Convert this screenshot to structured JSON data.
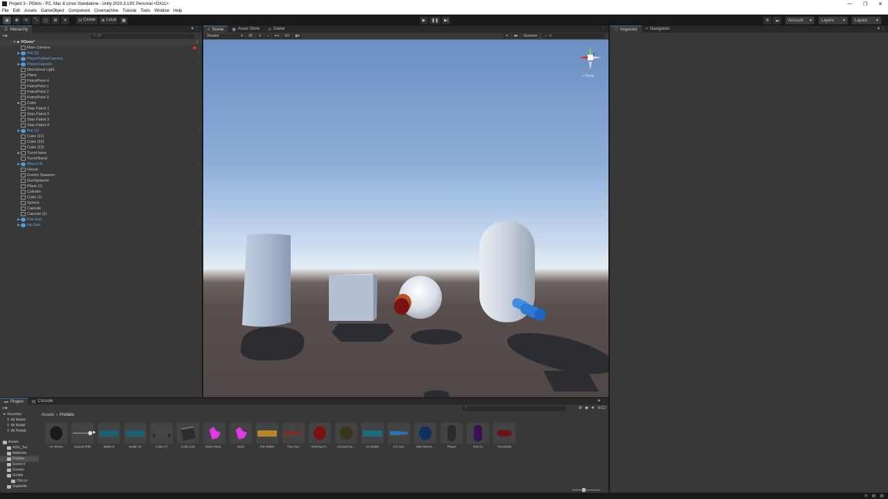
{
  "window": {
    "title": "Project 3 - POints - PC, Mac & Linux Standalone - Unity 2020.3.13f1 Personal <DX11>",
    "minimize": "—",
    "maximize": "❐",
    "close": "✕"
  },
  "menu": [
    "File",
    "Edit",
    "Assets",
    "GameObject",
    "Component",
    "Cinemachine",
    "Tutorial",
    "Tools",
    "Window",
    "Help"
  ],
  "toolbar": {
    "pivot": "Center",
    "space": "Local",
    "account": "Account",
    "layers": "Layers",
    "layout": "Layout"
  },
  "hierarchy": {
    "tab": "Hierarchy",
    "add": "+▾",
    "search_placeholder": "All",
    "scene": "POints*",
    "items": [
      {
        "name": "Main Camera",
        "prefab": false,
        "arrow": ""
      },
      {
        "name": "Rat (2)",
        "prefab": true,
        "arrow": "▶"
      },
      {
        "name": "PlayerFollowCamera",
        "prefab": true,
        "arrow": ""
      },
      {
        "name": "PlayerCapsule",
        "prefab": true,
        "arrow": "▶"
      },
      {
        "name": "Directional Light",
        "prefab": false,
        "arrow": ""
      },
      {
        "name": "Plane",
        "prefab": false,
        "arrow": ""
      },
      {
        "name": "PatrolPoint 4",
        "prefab": false,
        "arrow": ""
      },
      {
        "name": "PatrolPoint 1",
        "prefab": false,
        "arrow": ""
      },
      {
        "name": "PatrolPoint 2",
        "prefab": false,
        "arrow": ""
      },
      {
        "name": "PatrolPoint 3",
        "prefab": false,
        "arrow": ""
      },
      {
        "name": "Cube",
        "prefab": false,
        "arrow": "▶"
      },
      {
        "name": "Stair Patrol 1",
        "prefab": false,
        "arrow": ""
      },
      {
        "name": "Stair Patrol 2",
        "prefab": false,
        "arrow": ""
      },
      {
        "name": "Stair Patrol 3",
        "prefab": false,
        "arrow": ""
      },
      {
        "name": "Stair Patrol 4",
        "prefab": false,
        "arrow": ""
      },
      {
        "name": "Rat (1)",
        "prefab": true,
        "arrow": "▶"
      },
      {
        "name": "Cube (21)",
        "prefab": false,
        "arrow": ""
      },
      {
        "name": "Cube (22)",
        "prefab": false,
        "arrow": ""
      },
      {
        "name": "Cube (23)",
        "prefab": false,
        "arrow": ""
      },
      {
        "name": "Turret base",
        "prefab": false,
        "arrow": "▶"
      },
      {
        "name": "TurretStand",
        "prefab": false,
        "arrow": ""
      },
      {
        "name": "Move2 Ai",
        "prefab": true,
        "arrow": "▶"
      },
      {
        "name": "House",
        "prefab": false,
        "arrow": ""
      },
      {
        "name": "Enemy Spawner",
        "prefab": false,
        "arrow": ""
      },
      {
        "name": "GunSpawner",
        "prefab": false,
        "arrow": ""
      },
      {
        "name": "Plane (1)",
        "prefab": false,
        "arrow": ""
      },
      {
        "name": "Cylinder",
        "prefab": false,
        "arrow": ""
      },
      {
        "name": "Cube (1)",
        "prefab": false,
        "arrow": ""
      },
      {
        "name": "Sphere",
        "prefab": false,
        "arrow": ""
      },
      {
        "name": "Capsule",
        "prefab": false,
        "arrow": ""
      },
      {
        "name": "Capsule (1)",
        "prefab": false,
        "arrow": ""
      },
      {
        "name": "Fire Gun",
        "prefab": true,
        "arrow": "▶"
      },
      {
        "name": "Ice Gun",
        "prefab": true,
        "arrow": "▶"
      }
    ]
  },
  "scene": {
    "tabs": [
      "Scene",
      "Asset Store",
      "Game"
    ],
    "shading": "Shaded",
    "mode_2d": "2D",
    "gizmos": "Gizmos",
    "search_placeholder": "All",
    "persp": "< Persp",
    "colors": {
      "sky_top": "#6b8fc4",
      "horizon": "#e6ecf2",
      "ground": "#584e4d"
    }
  },
  "project": {
    "tabs": [
      "Project",
      "Console"
    ],
    "add": "+▾",
    "count": "12",
    "breadcrumb_root": "Assets",
    "breadcrumb_sep": "›",
    "breadcrumb_current": "Prefabs",
    "tree": [
      {
        "label": "Favorites",
        "kind": "star",
        "indent": 0
      },
      {
        "label": "All Materi",
        "kind": "search",
        "indent": 1
      },
      {
        "label": "All Model",
        "kind": "search",
        "indent": 1
      },
      {
        "label": "All Prefab",
        "kind": "search",
        "indent": 1
      },
      {
        "label": "",
        "kind": "spacer",
        "indent": 0
      },
      {
        "label": "Assets",
        "kind": "folder",
        "indent": 0
      },
      {
        "label": "ADG_Tex",
        "kind": "folder",
        "indent": 1
      },
      {
        "label": "Materials",
        "kind": "folder",
        "indent": 1
      },
      {
        "label": "Prefabs",
        "kind": "folder",
        "indent": 1,
        "selected": true
      },
      {
        "label": "Scene 0",
        "kind": "folder",
        "indent": 1
      },
      {
        "label": "Scenes",
        "kind": "folder",
        "indent": 1
      },
      {
        "label": "Scripts",
        "kind": "folder",
        "indent": 1
      },
      {
        "label": "Old scr",
        "kind": "folder",
        "indent": 2
      },
      {
        "label": "StarterAs",
        "kind": "folder",
        "indent": 1
      }
    ],
    "assets": [
      {
        "label": "Air stricity",
        "color": "#1a1a1a",
        "shape": "sphere"
      },
      {
        "label": "Assault Rifle",
        "color": "#555555",
        "shape": "rifle"
      },
      {
        "label": "Bullet 9",
        "color": "#1f5f74",
        "shape": "bar"
      },
      {
        "label": "Bullet 10",
        "color": "#1f5f74",
        "shape": "bar"
      },
      {
        "label": "Cube (7)",
        "color": "#454545",
        "shape": "bench"
      },
      {
        "label": "Cube (10)",
        "color": "#555555",
        "shape": "cube"
      },
      {
        "label": "Duck Varia...",
        "color": "#e23ae6",
        "shape": "duck"
      },
      {
        "label": "Duck",
        "color": "#e23ae6",
        "shape": "duck"
      },
      {
        "label": "Fire Bullet",
        "color": "#b8862a",
        "shape": "bar"
      },
      {
        "label": "Fire Gun",
        "color": "#7a3020",
        "shape": "gun"
      },
      {
        "label": "Flaming Fi...",
        "color": "#7a1212",
        "shape": "sphere"
      },
      {
        "label": "Ground Gu...",
        "color": "#3b3520",
        "shape": "sphere"
      },
      {
        "label": "Ice Bullet",
        "color": "#1e6b80",
        "shape": "bar"
      },
      {
        "label": "Ice Gun",
        "color": "#2673b5",
        "shape": "gun"
      },
      {
        "label": "Mist Monst...",
        "color": "#10305e",
        "shape": "sphere"
      },
      {
        "label": "Player",
        "color": "#2c2c2c",
        "shape": "capsule"
      },
      {
        "label": "Rat (1)",
        "color": "#3c1055",
        "shape": "capsule"
      },
      {
        "label": "TurretDisk",
        "color": "#6b1414",
        "shape": "disk"
      }
    ]
  },
  "inspector": {
    "tabs": [
      "Inspector",
      "Navigation"
    ]
  }
}
